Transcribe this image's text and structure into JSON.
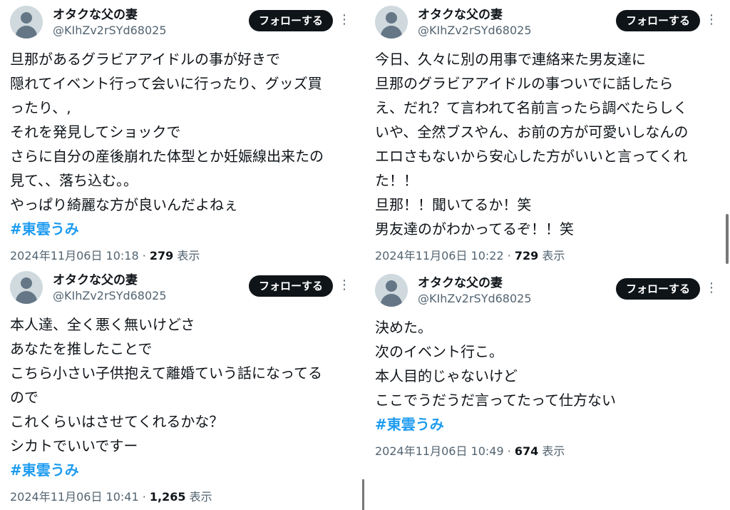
{
  "tweets": [
    {
      "display_name": "オタクな父の妻",
      "handle": "@KIhZv2rSYd68025",
      "follow_label": "フォローする",
      "lines": [
        "旦那があるグラビアアイドルの事が好きで",
        "隠れてイベント行って会いに行ったり、グッズ買",
        "ったり、,",
        "それを発見してショックで",
        "さらに自分の産後崩れた体型とか妊娠線出来たの",
        "見て、、落ち込む。。",
        "やっぱり綺麗な方が良いんだよねぇ"
      ],
      "hashtag": "#東雲うみ",
      "timestamp": "2024年11月06日 10:18",
      "separator": " · ",
      "views": "279",
      "views_label": " 表示"
    },
    {
      "display_name": "オタクな父の妻",
      "handle": "@KIhZv2rSYd68025",
      "follow_label": "フォローする",
      "lines": [
        "今日、久々に別の用事で連絡来た男友達に",
        "旦那のグラビアアイドルの事ついでに話したら",
        "え、だれ？て言われて名前言ったら調べたらしく",
        "いや、全然ブスやん、お前の方が可愛いしなんの",
        "エロさもないから安心した方がいいと言ってくれ",
        "た！！",
        "旦那！！聞いてるか！笑",
        "男友達のがわかってるぞ！！笑"
      ],
      "hashtag": "",
      "timestamp": "2024年11月06日 10:22",
      "separator": " · ",
      "views": "729",
      "views_label": " 表示"
    },
    {
      "display_name": "オタクな父の妻",
      "handle": "@KIhZv2rSYd68025",
      "follow_label": "フォローする",
      "lines": [
        "本人達、全く悪く無いけどさ",
        "あなたを推したことで",
        "こちら小さい子供抱えて離婚ていう話になってる",
        "ので",
        "これくらいはさせてくれるかな？",
        "シカトでいいですー"
      ],
      "hashtag": "#東雲うみ",
      "timestamp": "2024年11月06日 10:41",
      "separator": " · ",
      "views": "1,265",
      "views_label": " 表示"
    },
    {
      "display_name": "オタクな父の妻",
      "handle": "@KIhZv2rSYd68025",
      "follow_label": "フォローする",
      "lines": [
        "決めた。",
        "次のイベント行こ。",
        "本人目的じゃないけど",
        "ここでうだうだ言ってたって仕方ない"
      ],
      "hashtag": "#東雲うみ",
      "timestamp": "2024年11月06日 10:49",
      "separator": " · ",
      "views": "674",
      "views_label": " 表示"
    }
  ],
  "icons": {
    "avatar": "default-avatar-icon",
    "more": "more-options-icon"
  },
  "colors": {
    "text": "#0f1419",
    "muted": "#536471",
    "hashtag": "#1d9bf0",
    "follow_bg": "#0f1419"
  }
}
